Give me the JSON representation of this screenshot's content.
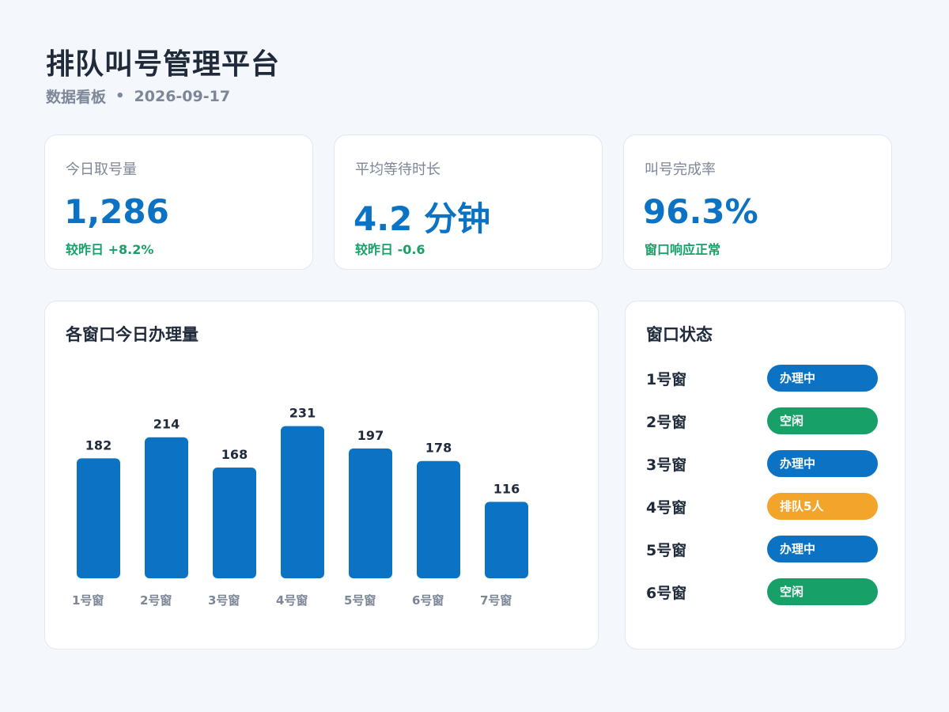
{
  "header": {
    "title": "排队叫号管理平台",
    "subtitle": "数据看板",
    "separator": "•",
    "date": "2026-09-17"
  },
  "kpis": [
    {
      "label": "今日取号量",
      "value": "1,286",
      "note": "较昨日 +8.2%"
    },
    {
      "label": "平均等待时长",
      "value": "4.2 分钟",
      "note": "较昨日 -0.6"
    },
    {
      "label": "叫号完成率",
      "value": "96.3%",
      "note": "窗口响应正常"
    }
  ],
  "chart": {
    "title": "各窗口今日办理量"
  },
  "chart_data": {
    "type": "bar",
    "title": "各窗口今日办理量",
    "categories": [
      "1号窗",
      "2号窗",
      "3号窗",
      "4号窗",
      "5号窗",
      "6号窗",
      "7号窗"
    ],
    "values": [
      182,
      214,
      168,
      231,
      197,
      178,
      116
    ],
    "xlabel": "",
    "ylabel": "",
    "grid": false,
    "bar_color": "#0b72c4"
  },
  "status_panel": {
    "title": "窗口状态",
    "rows": [
      {
        "name": "1号窗",
        "status": "办理中",
        "color": "#0b72c4"
      },
      {
        "name": "2号窗",
        "status": "空闲",
        "color": "#17a168"
      },
      {
        "name": "3号窗",
        "status": "办理中",
        "color": "#0b72c4"
      },
      {
        "name": "4号窗",
        "status": "排队5人",
        "color": "#f3a42a"
      },
      {
        "name": "5号窗",
        "status": "办理中",
        "color": "#0b72c4"
      },
      {
        "name": "6号窗",
        "status": "空闲",
        "color": "#17a168"
      }
    ]
  },
  "colors": {
    "accent": "#0b72c4",
    "positive": "#17a168",
    "warning": "#f3a42a"
  }
}
